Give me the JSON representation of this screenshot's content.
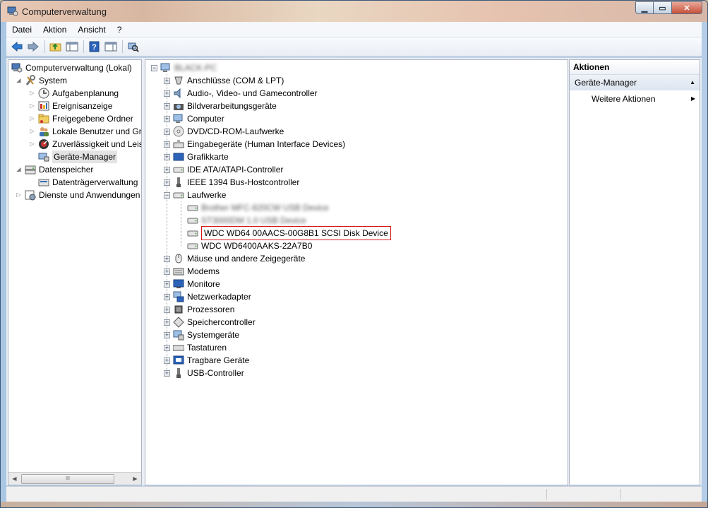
{
  "window": {
    "title": "Computerverwaltung"
  },
  "menu": [
    "Datei",
    "Aktion",
    "Ansicht",
    "?"
  ],
  "toolbar": {
    "icons": [
      "back-icon",
      "forward-icon",
      "up-folder-icon",
      "show-hide-tree-icon",
      "help-icon",
      "show-hide-action-pane-icon",
      "scan-hardware-icon"
    ]
  },
  "left_tree": {
    "root": "Computerverwaltung (Lokal)",
    "system": "System",
    "system_children": [
      "Aufgabenplanung",
      "Ereignisanzeige",
      "Freigegebene Ordner",
      "Lokale Benutzer und Gr",
      "Zuverlässigkeit und Leis",
      "Geräte-Manager"
    ],
    "storage": "Datenspeicher",
    "storage_children": [
      "Datenträgerverwaltung"
    ],
    "services": "Dienste und Anwendungen",
    "scroll_mark": "III"
  },
  "device_tree": {
    "computer_name": "BLACK-PC",
    "categories_before": [
      "Anschlüsse (COM & LPT)",
      "Audio-, Video- und Gamecontroller",
      "Bildverarbeitungsgeräte",
      "Computer",
      "DVD/CD-ROM-Laufwerke",
      "Eingabegeräte (Human Interface Devices)",
      "Grafikkarte",
      "IDE ATA/ATAPI-Controller",
      "IEEE 1394 Bus-Hostcontroller"
    ],
    "drives_label": "Laufwerke",
    "drives": [
      "Brother MFC-820CW USB Device",
      "ST3000DM 1.0 USB Device",
      "WDC WD64 00AACS-00G8B1 SCSI Disk Device",
      "WDC WD6400AAKS-22A7B0"
    ],
    "categories_after": [
      "Mäuse und andere Zeigegeräte",
      "Modems",
      "Monitore",
      "Netzwerkadapter",
      "Prozessoren",
      "Speichercontroller",
      "Systemgeräte",
      "Tastaturen",
      "Tragbare Geräte",
      "USB-Controller"
    ]
  },
  "actions": {
    "header": "Aktionen",
    "section": "Geräte-Manager",
    "item": "Weitere Aktionen"
  }
}
